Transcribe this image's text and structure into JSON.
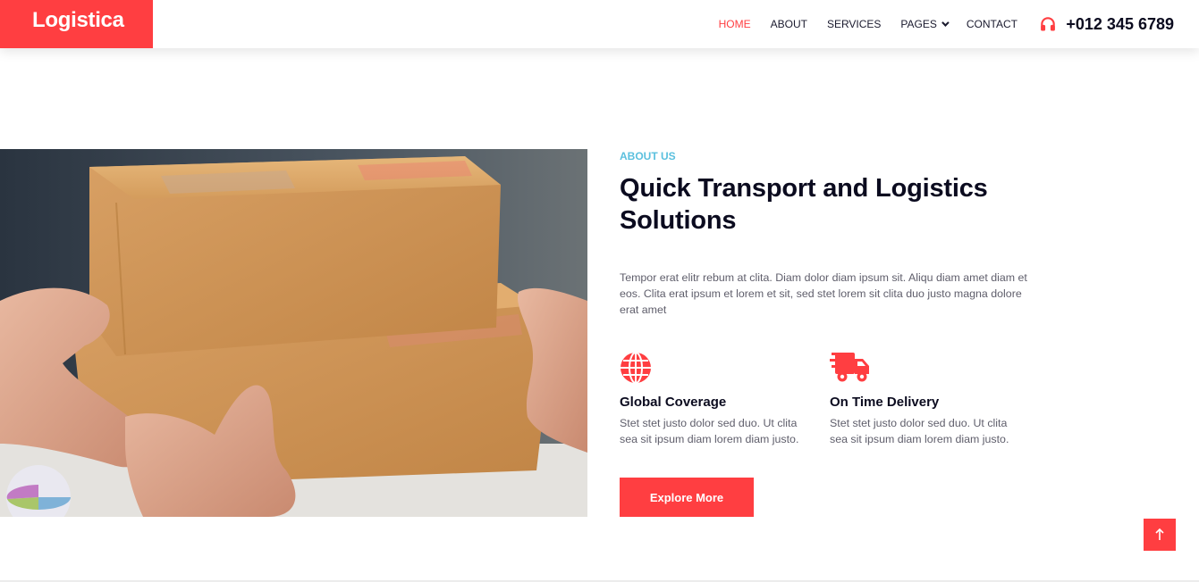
{
  "brand": {
    "name": "Logistica"
  },
  "nav": {
    "items": [
      {
        "label": "HOME",
        "active": true
      },
      {
        "label": "ABOUT"
      },
      {
        "label": "SERVICES"
      },
      {
        "label": "PAGES",
        "dropdown": true
      },
      {
        "label": "CONTACT"
      }
    ],
    "phone": {
      "icon": "headphones-icon",
      "number": "+012 345 6789"
    }
  },
  "about": {
    "eyebrow": "ABOUT US",
    "heading": "Quick Transport and Logistics Solutions",
    "paragraph": "Tempor erat elitr rebum at clita. Diam dolor diam ipsum sit. Aliqu diam amet diam et eos. Clita erat ipsum et lorem et sit, sed stet lorem sit clita duo justo magna dolore erat amet",
    "features": [
      {
        "icon": "globe-icon",
        "title": "Global Coverage",
        "text": "Stet stet justo dolor sed duo. Ut clita sea sit ipsum diam lorem diam justo."
      },
      {
        "icon": "shipping-fast-icon",
        "title": "On Time Delivery",
        "text": "Stet stet justo dolor sed duo. Ut clita sea sit ipsum diam lorem diam justo."
      }
    ],
    "cta": "Explore More"
  },
  "colors": {
    "accent": "#ff3e41",
    "eyebrow": "#5bc0de",
    "heading": "#0b0b1f"
  },
  "back_to_top": {
    "icon": "arrow-up-icon"
  }
}
